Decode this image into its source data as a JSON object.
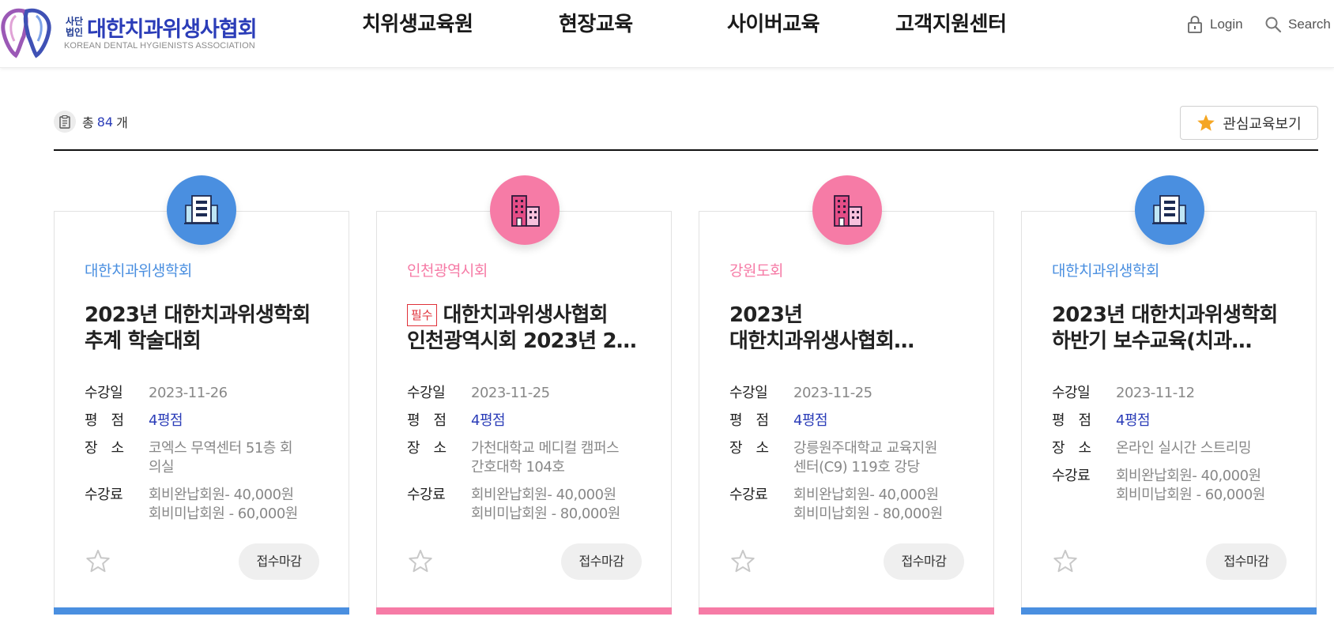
{
  "header": {
    "logo": {
      "prefix_line1": "사단",
      "prefix_line2": "법인",
      "name": "대한치과위생사협회",
      "subtitle": "KOREAN DENTAL HYGIENISTS ASSOCIATION"
    },
    "nav": [
      "치위생교육원",
      "현장교육",
      "사이버교육",
      "고객지원센터"
    ],
    "login_label": "Login",
    "search_label": "Search"
  },
  "summary": {
    "prefix": "총",
    "count": "84",
    "suffix": "개",
    "fav_button_label": "관심교육보기"
  },
  "labels": {
    "date": "수강일",
    "rating": "평　점",
    "place": "장　소",
    "fee": "수강료"
  },
  "cards": [
    {
      "org": "대한치과위생학회",
      "color": "#4a8fe0",
      "icon": "office-building-icon",
      "tag": "",
      "title_line1": "2023년 대한치과위생학회",
      "title_line2": "추계 학술대회",
      "date": "2023-11-26",
      "rating": "4평점",
      "place_line1": "코엑스 무역센터 51층 회",
      "place_line2": "의실",
      "fee_line1": "회비완납회원- 40,000원",
      "fee_line2": "회비미납회원 - 60,000원",
      "status": "접수마감"
    },
    {
      "org": "인천광역시회",
      "color": "#f67ba6",
      "icon": "city-buildings-icon",
      "tag": "필수",
      "title_line1": "대한치과위생사협회",
      "title_line2": "인천광역시회 2023년 2…",
      "date": "2023-11-25",
      "rating": "4평점",
      "place_line1": "가천대학교 메디컬 캠퍼스",
      "place_line2": "간호대학 104호",
      "fee_line1": "회비완납회원- 40,000원",
      "fee_line2": "회비미납회원 - 80,000원",
      "status": "접수마감"
    },
    {
      "org": "강원도회",
      "color": "#f67ba6",
      "icon": "city-buildings-icon",
      "tag": "",
      "title_line1": "2023년",
      "title_line2": "대한치과위생사협회…",
      "date": "2023-11-25",
      "rating": "4평점",
      "place_line1": "강릉원주대학교 교육지원",
      "place_line2": "센터(C9) 119호 강당",
      "fee_line1": "회비완납회원- 40,000원",
      "fee_line2": "회비미납회원 - 80,000원",
      "status": "접수마감"
    },
    {
      "org": "대한치과위생학회",
      "color": "#4a8fe0",
      "icon": "office-building-icon",
      "tag": "",
      "title_line1": "2023년 대한치과위생학회",
      "title_line2": "하반기 보수교육(치과…",
      "date": "2023-11-12",
      "rating": "4평점",
      "place_line1": "온라인 실시간 스트리밍",
      "place_line2": "",
      "fee_line1": "회비완납회원- 40,000원",
      "fee_line2": "회비미납회원 - 60,000원",
      "status": "접수마감"
    }
  ],
  "colors": {
    "accent": "#2b3db8",
    "blue": "#4a8fe0",
    "pink": "#f67ba6",
    "required": "#e0323a"
  }
}
